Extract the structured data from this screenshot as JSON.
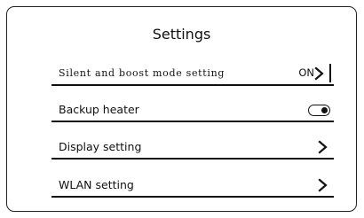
{
  "title": "Settings",
  "rows": [
    {
      "label": "Silent and boost mode setting",
      "status": "ON",
      "icon": "chevron-right-icon"
    },
    {
      "label": "Backup heater",
      "toggle_on": true,
      "icon": "toggle-switch"
    },
    {
      "label": "Display setting",
      "icon": "chevron-right-icon"
    },
    {
      "label": "WLAN setting",
      "icon": "chevron-right-icon"
    }
  ]
}
